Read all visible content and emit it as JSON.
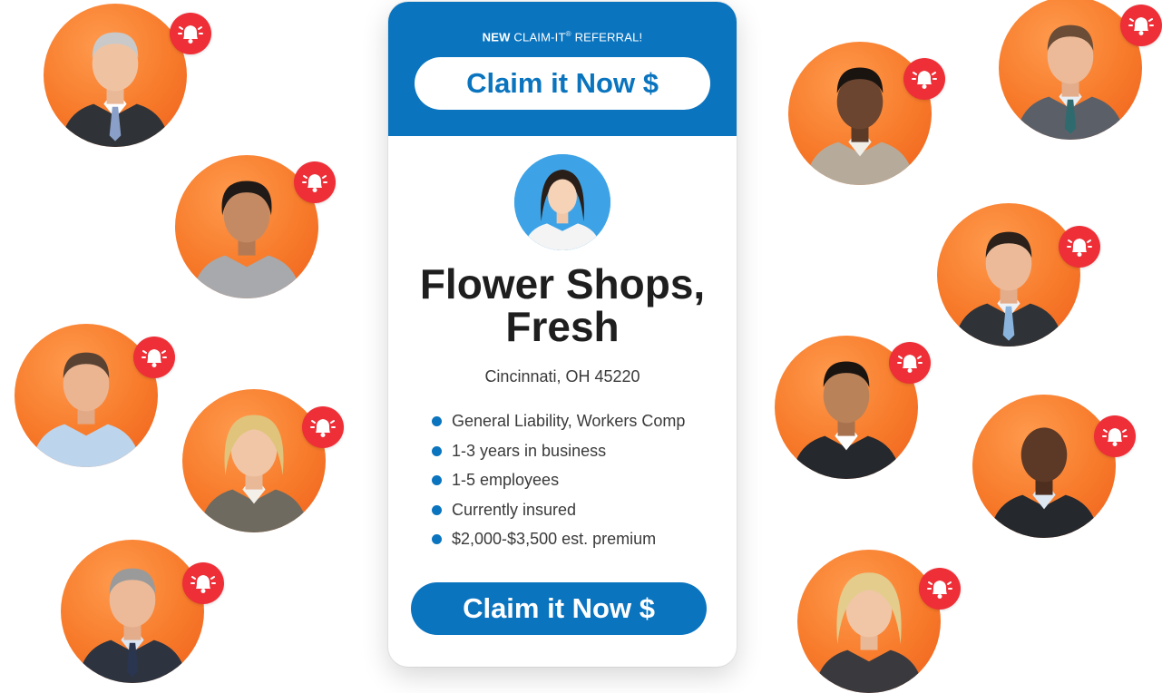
{
  "header": {
    "eyebrow_strong": "NEW",
    "eyebrow_text": "CLAIM-IT",
    "eyebrow_mark": "®",
    "eyebrow_suffix": "REFERRAL!",
    "cta_label": "Claim it Now $"
  },
  "listing": {
    "title_line1": "Flower Shops,",
    "title_line2": "Fresh",
    "location": "Cincinnati, OH 45220",
    "features": [
      "General Liability, Workers Comp",
      "1-3 years in business",
      "1-5 employees",
      "Currently insured",
      "$2,000-$3,500 est. premium"
    ],
    "cta_label": "Claim it Now $"
  },
  "icons": {
    "bell": "bell-alert-icon",
    "avatar": "person-avatar"
  },
  "colors": {
    "brand_blue": "#0a74bf",
    "alert_red": "#ee2f37",
    "bubble_orange": "#f77a2a",
    "text_dark": "#1e1e1e"
  }
}
